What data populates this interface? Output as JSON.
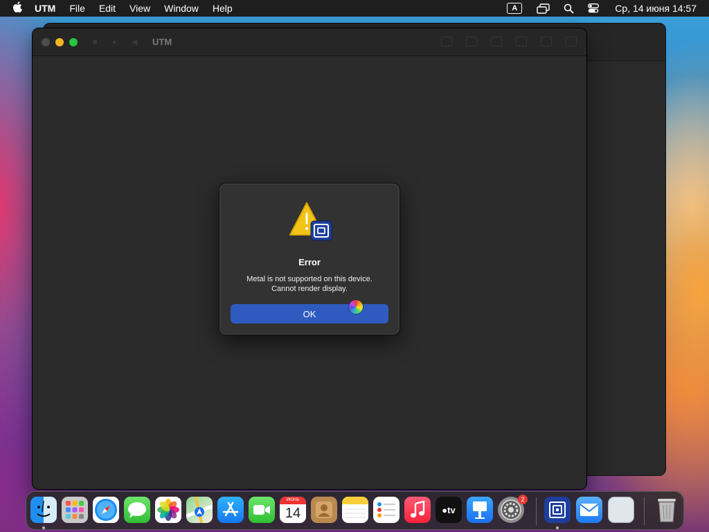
{
  "menubar": {
    "app_name": "UTM",
    "items": [
      "File",
      "Edit",
      "View",
      "Window",
      "Help"
    ],
    "input_source": "A",
    "clock": "Ср, 14 июня  14:57"
  },
  "window": {
    "title": "UTM"
  },
  "dialog": {
    "title": "Error",
    "message_line1": "Metal is not supported on this device.",
    "message_line2": "Cannot render display.",
    "ok_label": "OK"
  },
  "dock": {
    "calendar_month": "ИЮНЬ",
    "calendar_day": "14",
    "tv_label": "tv",
    "settings_badge": "2",
    "items": [
      {
        "name": "finder-icon"
      },
      {
        "name": "launchpad-icon"
      },
      {
        "name": "safari-icon"
      },
      {
        "name": "messages-icon"
      },
      {
        "name": "photos-icon"
      },
      {
        "name": "maps-icon"
      },
      {
        "name": "app-store-icon"
      },
      {
        "name": "facetime-icon"
      },
      {
        "name": "calendar-icon"
      },
      {
        "name": "contacts-icon"
      },
      {
        "name": "notes-icon"
      },
      {
        "name": "reminders-icon"
      },
      {
        "name": "music-icon"
      },
      {
        "name": "apple-tv-icon"
      },
      {
        "name": "keynote-icon"
      },
      {
        "name": "system-preferences-icon"
      },
      {
        "name": "utm-icon"
      },
      {
        "name": "mail-icon"
      },
      {
        "name": "preview-icon"
      },
      {
        "name": "trash-icon"
      }
    ]
  },
  "colors": {
    "accent_button": "#2f5bc1",
    "dialog_bg": "#323232",
    "window_bg": "#2b2b2b"
  }
}
